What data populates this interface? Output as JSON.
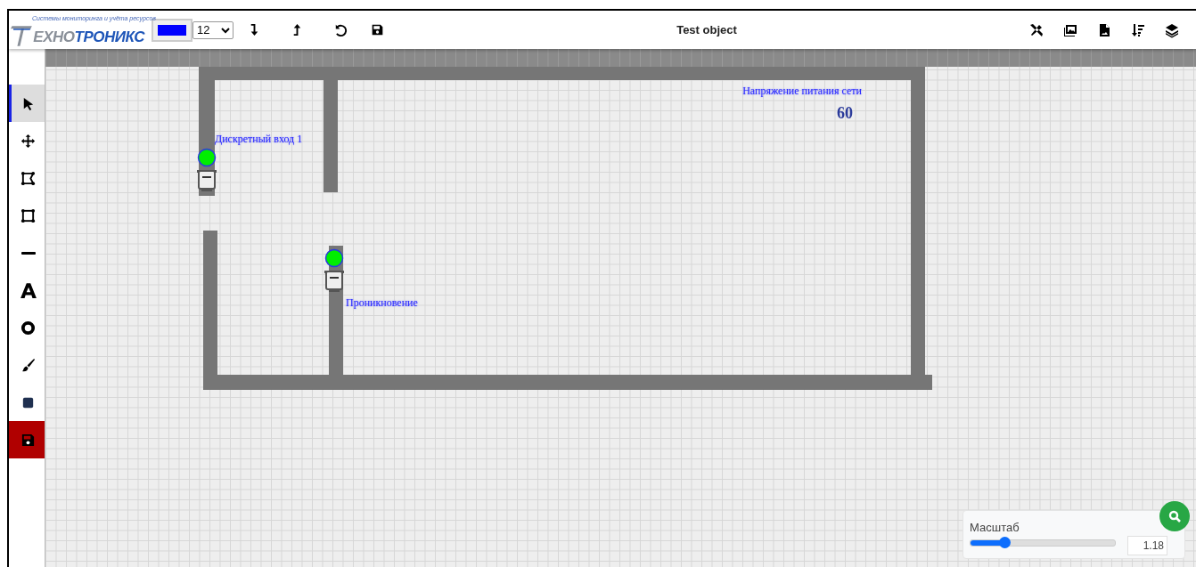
{
  "header": {
    "logo": {
      "caption": "Системы мониторинга и учёта ресурсов",
      "text_grey": "ЕХНО",
      "text_blue": "ТРОНИКС"
    },
    "color_picker": {
      "color": "#0000ff"
    },
    "font_size": {
      "value": "12"
    },
    "title": "Test object"
  },
  "tools": [
    {
      "kind": "pointer",
      "selected": true
    },
    {
      "kind": "move",
      "selected": false
    },
    {
      "kind": "polygon",
      "selected": false
    },
    {
      "kind": "rectangle",
      "selected": false
    },
    {
      "kind": "line",
      "selected": false
    },
    {
      "kind": "text",
      "selected": false
    },
    {
      "kind": "circle",
      "selected": false
    },
    {
      "kind": "brush",
      "selected": false
    },
    {
      "kind": "fill",
      "selected": false
    },
    {
      "kind": "save",
      "selected": false
    }
  ],
  "canvas": {
    "sensors": [
      {
        "label": "Дискретный вход 1",
        "active": true
      },
      {
        "label": "Проникновение",
        "active": true
      }
    ],
    "readings": [
      {
        "label": "Напряжение питания сети",
        "value": "60"
      }
    ]
  },
  "scale": {
    "label": "Масштаб",
    "level": 0.24,
    "value": "1.18"
  }
}
